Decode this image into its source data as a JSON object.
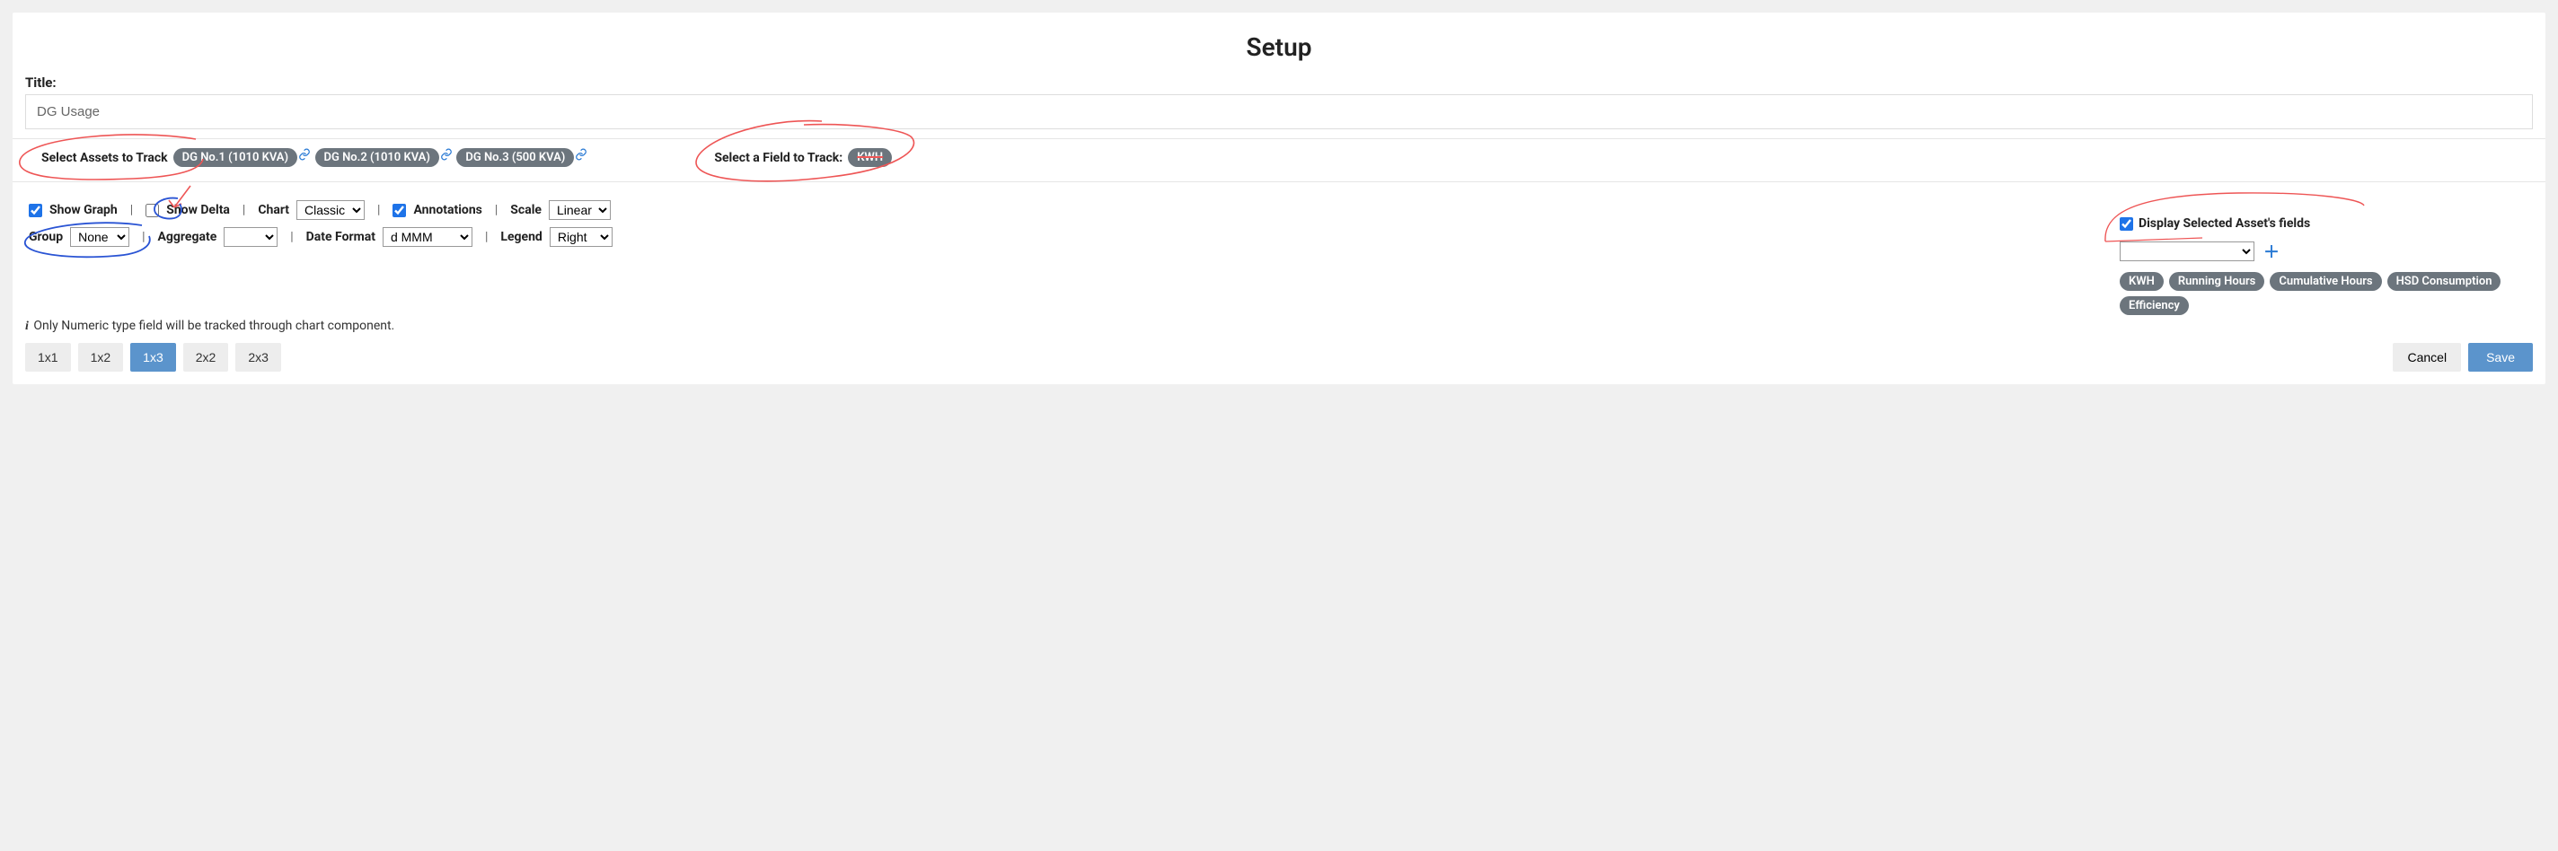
{
  "page_title": "Setup",
  "labels": {
    "title": "Title:",
    "select_assets": "Select Assets to Track",
    "select_field": "Select a Field to Track:",
    "show_graph": "Show Graph",
    "show_delta": "Show Delta",
    "chart": "Chart",
    "annotations": "Annotations",
    "scale": "Scale",
    "group": "Group",
    "aggregate": "Aggregate",
    "date_format": "Date Format",
    "legend": "Legend",
    "display_fields": "Display Selected Asset's fields",
    "info": "Only Numeric type field will be tracked through chart component."
  },
  "values": {
    "title": "DG Usage",
    "chart": "Classic",
    "scale": "Linear",
    "group": "None",
    "aggregate": "",
    "date_format": "d MMM",
    "legend": "Right",
    "field_select": ""
  },
  "checkboxes": {
    "show_graph": true,
    "show_delta": false,
    "annotations": true,
    "display_fields": true
  },
  "assets": [
    "DG No.1 (1010 KVA)",
    "DG No.2 (1010 KVA)",
    "DG No.3 (500 KVA)"
  ],
  "field_tag": "KWH",
  "field_pills": [
    "KWH",
    "Running Hours",
    "Cumulative Hours",
    "HSD Consumption",
    "Efficiency"
  ],
  "size_buttons": [
    "1x1",
    "1x2",
    "1x3",
    "2x2",
    "2x3"
  ],
  "size_active": "1x3",
  "buttons": {
    "cancel": "Cancel",
    "save": "Save"
  }
}
